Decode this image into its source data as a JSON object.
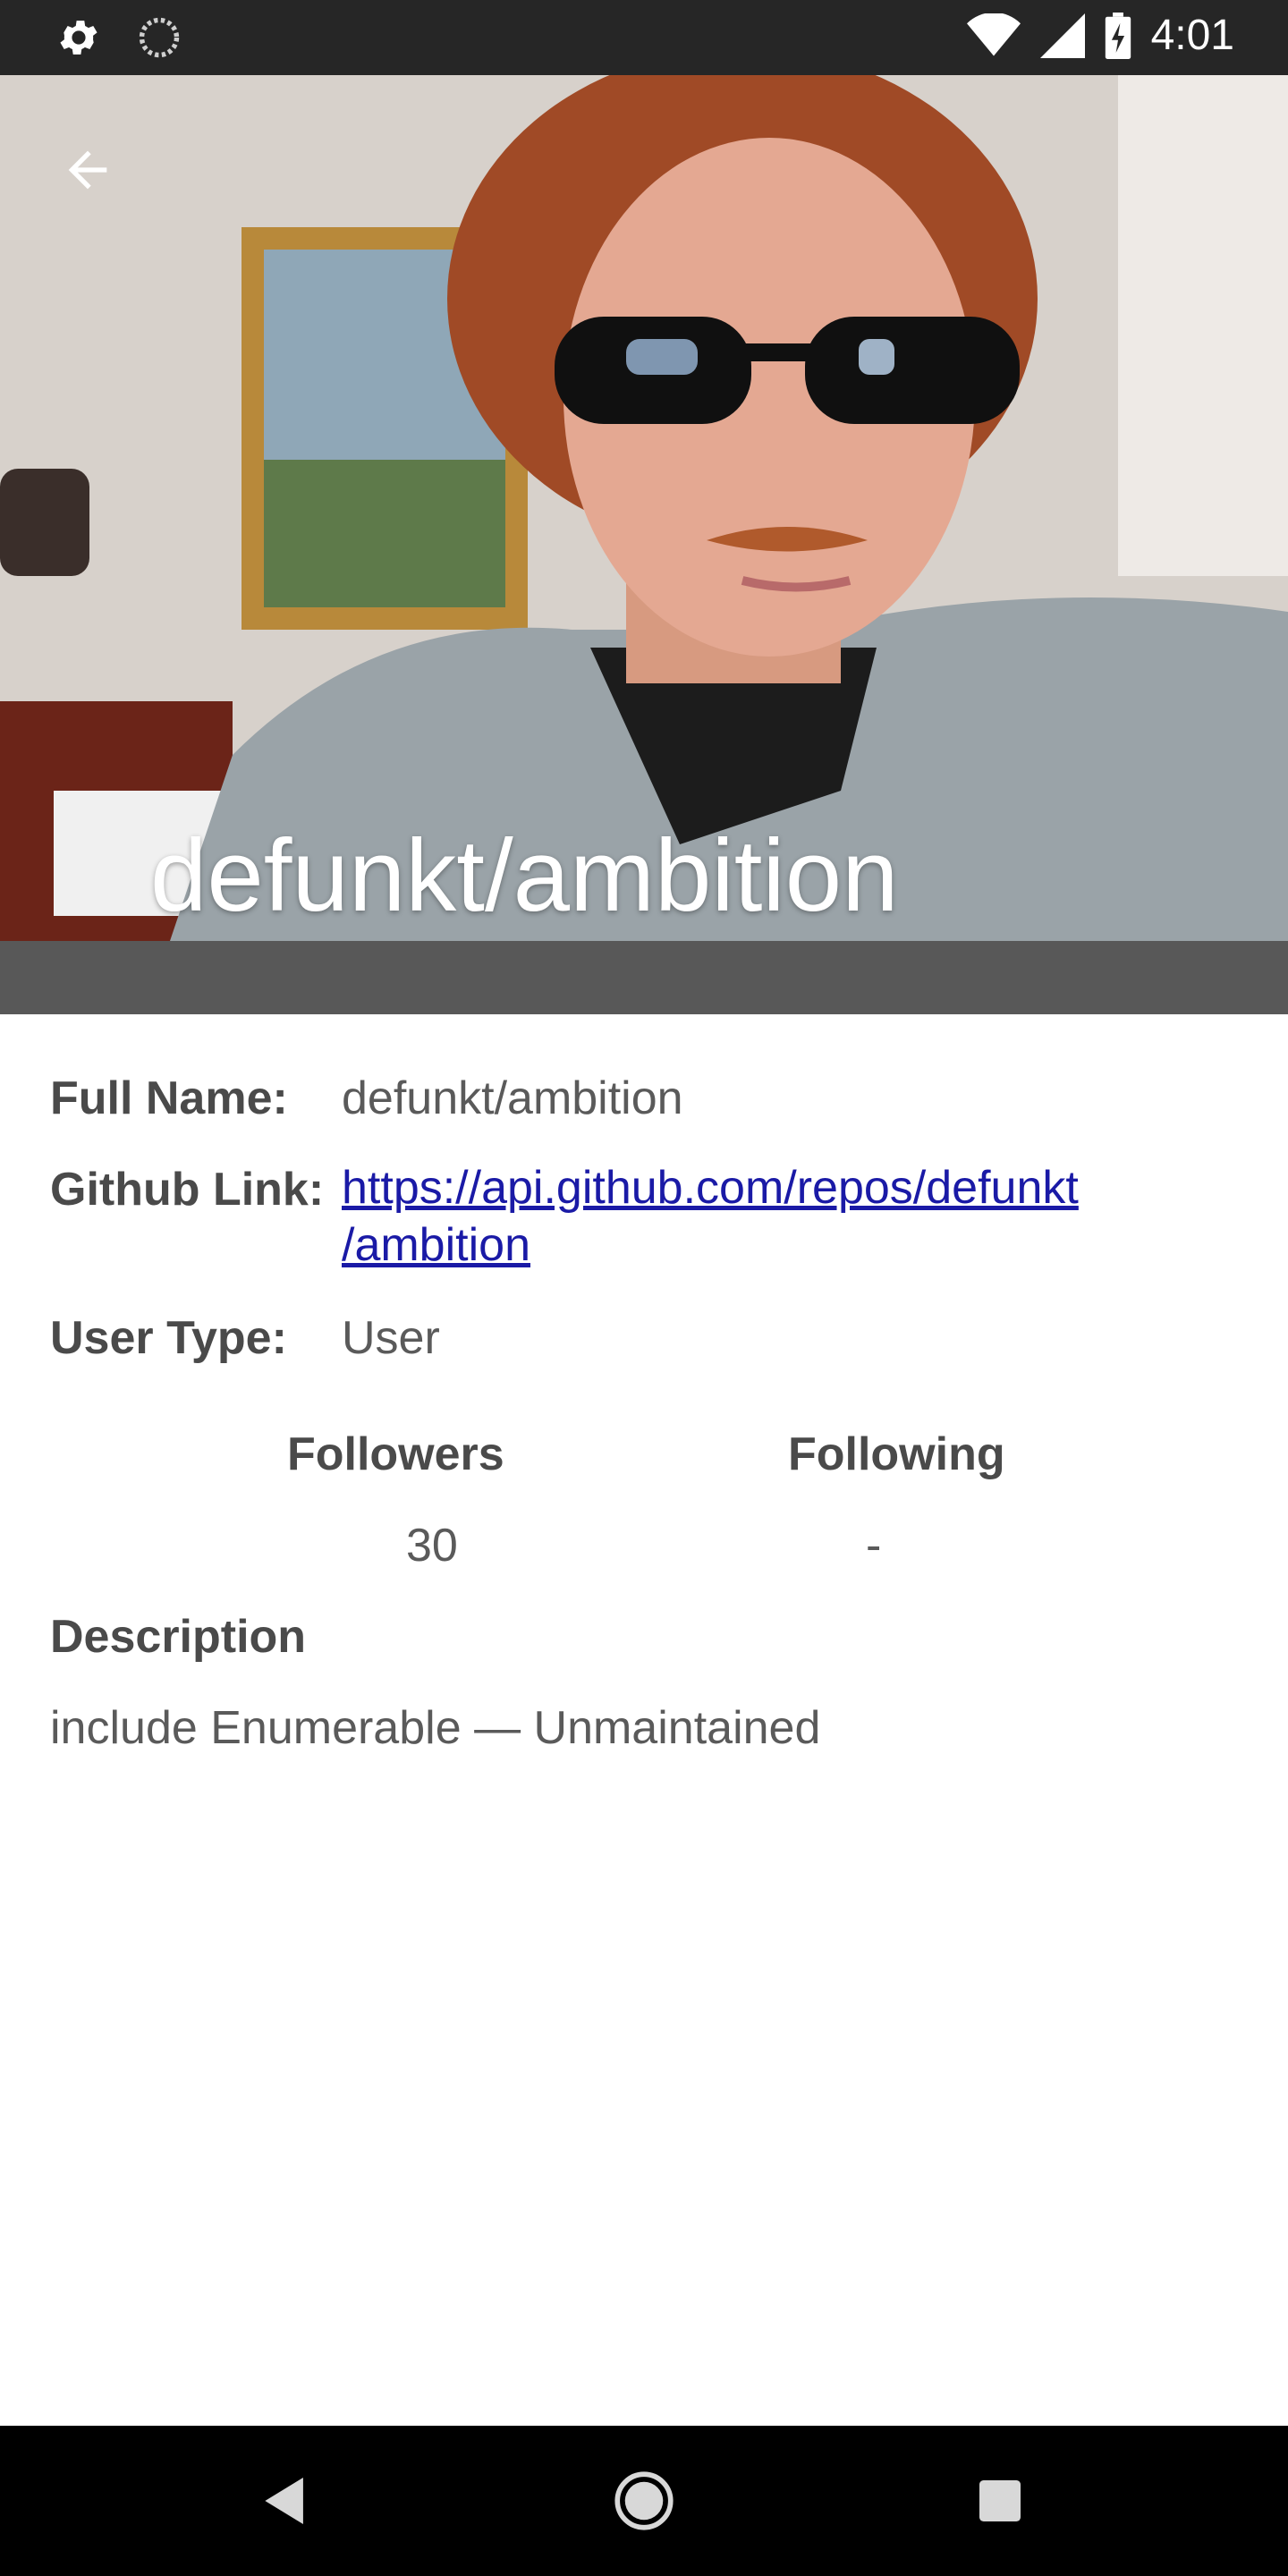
{
  "status_bar": {
    "time": "4:01",
    "left_icons": [
      "gear-icon",
      "sync-icon"
    ],
    "right_icons": [
      "wifi-icon",
      "signal-icon",
      "battery-icon"
    ]
  },
  "header": {
    "title": "defunkt/ambition",
    "back_icon": "arrow-left-icon",
    "band_color": "#585858"
  },
  "details": {
    "full_name_label": "Full Name:",
    "full_name_value": "defunkt/ambition",
    "github_link_label": "Github Link:",
    "github_link_line1": "https://api.github.com/repos/defunkt",
    "github_link_line2": "/ambition",
    "user_type_label": "User Type:",
    "user_type_value": "User"
  },
  "stats": {
    "followers_label": "Followers",
    "followers_value": "30",
    "following_label": "Following",
    "following_value": "-"
  },
  "description": {
    "label": "Description",
    "text": "include Enumerable — Unmaintained"
  },
  "nav_bar": {
    "icons": [
      "back-triangle-icon",
      "home-circle-icon",
      "recents-square-icon"
    ]
  },
  "colors": {
    "status_bar": "#262626",
    "link": "#1a1aa6",
    "label_text": "#4a4a4a",
    "value_text": "#5a5a5a"
  }
}
